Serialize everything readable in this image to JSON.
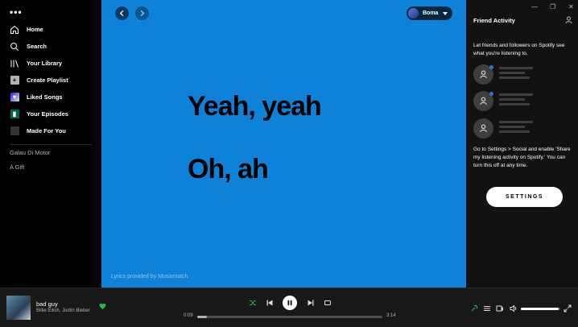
{
  "sidebar": {
    "menu_icon": "more-dots-icon",
    "items": [
      {
        "label": "Home",
        "icon": "home-icon"
      },
      {
        "label": "Search",
        "icon": "search-icon"
      },
      {
        "label": "Your Library",
        "icon": "library-icon"
      },
      {
        "label": "Create Playlist",
        "icon": "plus-icon"
      },
      {
        "label": "Liked Songs",
        "icon": "heart-icon"
      },
      {
        "label": "Your Episodes",
        "icon": "bookmark-icon"
      },
      {
        "label": "Made For You",
        "icon": "square-icon"
      }
    ],
    "playlists": [
      "Galau Di Motor",
      "A Gift"
    ]
  },
  "main": {
    "background": "#0d82d8",
    "user_name": "Boma",
    "lyrics": [
      "Yeah, yeah",
      "Oh, ah"
    ],
    "credit": "Lyrics provided by Musixmatch"
  },
  "friends": {
    "title": "Friend Activity",
    "intro": "Let friends and followers on Spotify see what you're listening to.",
    "instructions": "Go to Settings > Social and enable 'Share my listening activity on Spotify.' You can turn this off at any time.",
    "settings_label": "SETTINGS"
  },
  "player": {
    "song": "bad guy",
    "artist": "Billie Eilish, Justin Bieber",
    "elapsed": "0:09",
    "duration": "3:14",
    "progress": 0.05,
    "volume": 0.95,
    "accent": "#1db954"
  }
}
